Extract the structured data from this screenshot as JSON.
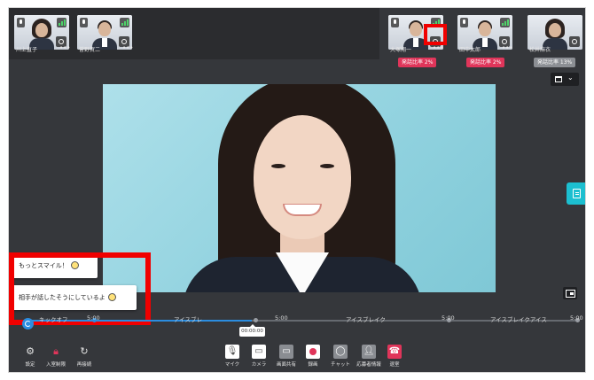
{
  "participants_left": [
    {
      "name": "川上直子",
      "more": "•••"
    },
    {
      "name": "菅野賀二",
      "more": "•••"
    }
  ],
  "participants_right": [
    {
      "name": "大塚翔一",
      "more": "•••",
      "ratio": "発話比率 2%"
    },
    {
      "name": "田中太郎",
      "more": "•••",
      "ratio": "発話比率 2%"
    },
    {
      "name": "松井麻衣",
      "ratio": "発話比率 13%"
    }
  ],
  "timeline": {
    "segments": [
      "キックオフ",
      "5:00",
      "アイスブレ",
      "5:00",
      "アイスブレイク",
      "5:00",
      "アイスブレイクアイス",
      "5:00"
    ],
    "current_time": "00:00:00"
  },
  "toolbar": {
    "settings": "設定",
    "entry_limit": "入室制限",
    "reconnect": "再接続",
    "mic": "マイク",
    "camera": "カメラ",
    "screen_share": "画面共有",
    "record": "録画",
    "chat": "チャット",
    "applicant_info": "応募者情報",
    "leave": "退室"
  },
  "hints": [
    "もっとスマイル！",
    "相手が話したそうにしているよ"
  ],
  "colors": {
    "accent_blue": "#2b8de0",
    "speech_ratio_red": "#e0355a",
    "side_tab_cyan": "#1cbfd0",
    "highlight_red": "#f00000"
  }
}
